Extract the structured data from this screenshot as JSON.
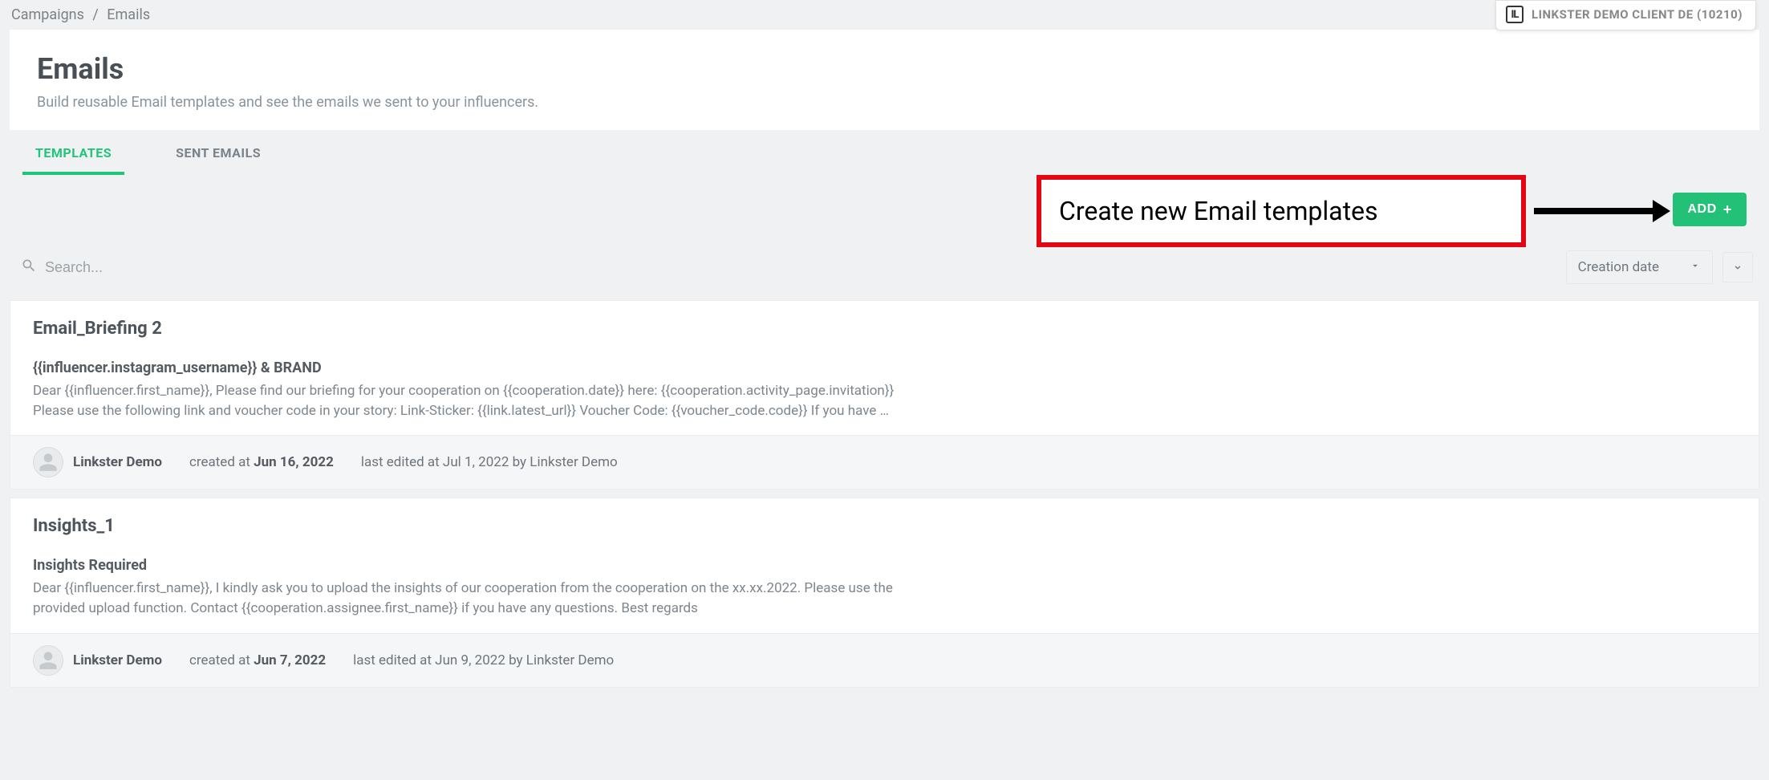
{
  "breadcrumb": {
    "root": "Campaigns",
    "current": "Emails"
  },
  "client_chip": {
    "logo_text": "IL",
    "label": "LINKSTER DEMO CLIENT DE (10210)"
  },
  "header": {
    "title": "Emails",
    "subtitle": "Build reusable Email templates and see the emails we sent to your influencers."
  },
  "tabs": [
    {
      "label": "TEMPLATES",
      "active": true
    },
    {
      "label": "SENT EMAILS",
      "active": false
    }
  ],
  "callout": {
    "text": "Create new Email templates"
  },
  "add_button": {
    "label": "ADD"
  },
  "search": {
    "placeholder": "Search..."
  },
  "sort": {
    "label": "Creation date"
  },
  "templates": [
    {
      "title": "Email_Briefing 2",
      "subject": "{{influencer.instagram_username}} & BRAND",
      "preview": "Dear {{influencer.first_name}}, Please find our briefing for your cooperation on {{cooperation.date}} here: {{cooperation.activity_page.invitation}} Please use the following link and voucher code in your story: Link-Sticker: {{link.latest_url}} Voucher Code: {{voucher_code.code}} If you have …",
      "author": "Linkster Demo",
      "created_prefix": "created at ",
      "created_date": "Jun 16, 2022",
      "edited_text": "last edited at Jul 1, 2022 by Linkster Demo"
    },
    {
      "title": "Insights_1",
      "subject": "Insights Required",
      "preview": "Dear {{influencer.first_name}}, I kindly ask you to upload the insights of our cooperation from the cooperation on the xx.xx.2022.\nPlease use the provided upload function. Contact {{cooperation.assignee.first_name}} if you have any questions. Best regards",
      "author": "Linkster Demo",
      "created_prefix": "created at ",
      "created_date": "Jun 7, 2022",
      "edited_text": "last edited at Jun 9, 2022 by Linkster Demo"
    }
  ]
}
